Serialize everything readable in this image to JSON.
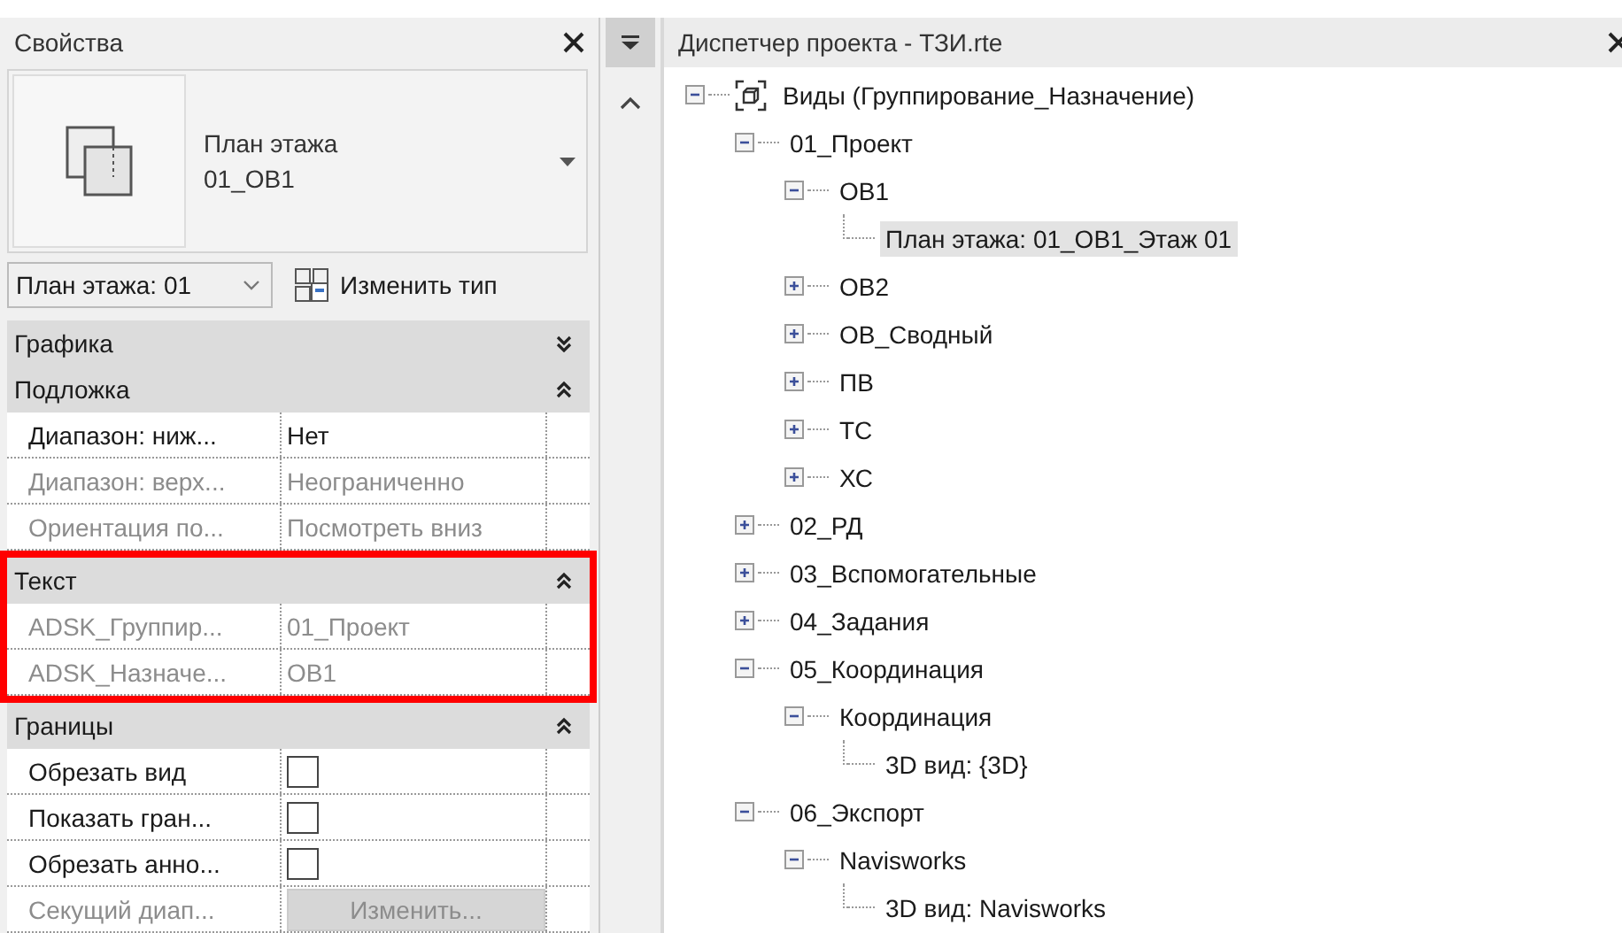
{
  "properties": {
    "title": "Свойства",
    "type_selector": {
      "category": "План этажа",
      "name": "01_ОВ1"
    },
    "instance_select": {
      "value": "План этажа: 01"
    },
    "edit_type_button": "Изменить тип",
    "sections": [
      {
        "title": "Графика",
        "expanded": false,
        "highlighted": false
      },
      {
        "title": "Подложка",
        "expanded": true,
        "highlighted": false,
        "rows": [
          {
            "label": "Диапазон: ниж...",
            "kind": "text",
            "value": "Нет",
            "disabled": false
          },
          {
            "label": "Диапазон: верх...",
            "kind": "text",
            "value": "Неограниченно",
            "disabled": true
          },
          {
            "label": "Ориентация по...",
            "kind": "text",
            "value": "Посмотреть вниз",
            "disabled": true
          }
        ]
      },
      {
        "title": "Текст",
        "expanded": true,
        "highlighted": true,
        "rows": [
          {
            "label": "ADSK_Группир...",
            "kind": "text",
            "value": "01_Проект",
            "disabled": true
          },
          {
            "label": "ADSK_Назначе...",
            "kind": "text",
            "value": "ОВ1",
            "disabled": true
          }
        ]
      },
      {
        "title": "Границы",
        "expanded": true,
        "highlighted": false,
        "rows": [
          {
            "label": "Обрезать вид",
            "kind": "checkbox",
            "checked": false,
            "disabled": false
          },
          {
            "label": "Показать гран...",
            "kind": "checkbox",
            "checked": false,
            "disabled": false
          },
          {
            "label": "Обрезать анно...",
            "kind": "checkbox",
            "checked": false,
            "disabled": false
          },
          {
            "label": "Секущий диап...",
            "kind": "button",
            "value": "Изменить...",
            "disabled": true
          }
        ]
      }
    ]
  },
  "project_browser": {
    "title": "Диспетчер проекта - ТЗИ.rte",
    "tree": [
      {
        "label": "Виды (Группирование_Назначение)",
        "expanded": true,
        "selected": false,
        "children": [
          {
            "label": "01_Проект",
            "expanded": true,
            "selected": false,
            "children": [
              {
                "label": "ОВ1",
                "expanded": true,
                "selected": false,
                "children": [
                  {
                    "label": "План этажа: 01_ОВ1_Этаж 01",
                    "selected": true
                  }
                ]
              },
              {
                "label": "ОВ2",
                "expanded": false,
                "selected": false
              },
              {
                "label": "ОВ_Сводный",
                "expanded": false,
                "selected": false
              },
              {
                "label": "ПВ",
                "expanded": false,
                "selected": false
              },
              {
                "label": "ТС",
                "expanded": false,
                "selected": false
              },
              {
                "label": "ХС",
                "expanded": false,
                "selected": false
              }
            ]
          },
          {
            "label": "02_РД",
            "expanded": false,
            "selected": false
          },
          {
            "label": "03_Вспомогательные",
            "expanded": false,
            "selected": false
          },
          {
            "label": "04_Задания",
            "expanded": false,
            "selected": false
          },
          {
            "label": "05_Координация",
            "expanded": true,
            "selected": false,
            "children": [
              {
                "label": "Координация",
                "expanded": true,
                "selected": false,
                "children": [
                  {
                    "label": "3D вид: {3D}",
                    "selected": false
                  }
                ]
              }
            ]
          },
          {
            "label": "06_Экспорт",
            "expanded": true,
            "selected": false,
            "children": [
              {
                "label": "Navisworks",
                "expanded": true,
                "selected": false,
                "children": [
                  {
                    "label": "3D вид: Navisworks",
                    "selected": false
                  }
                ]
              }
            ]
          }
        ]
      }
    ]
  }
}
